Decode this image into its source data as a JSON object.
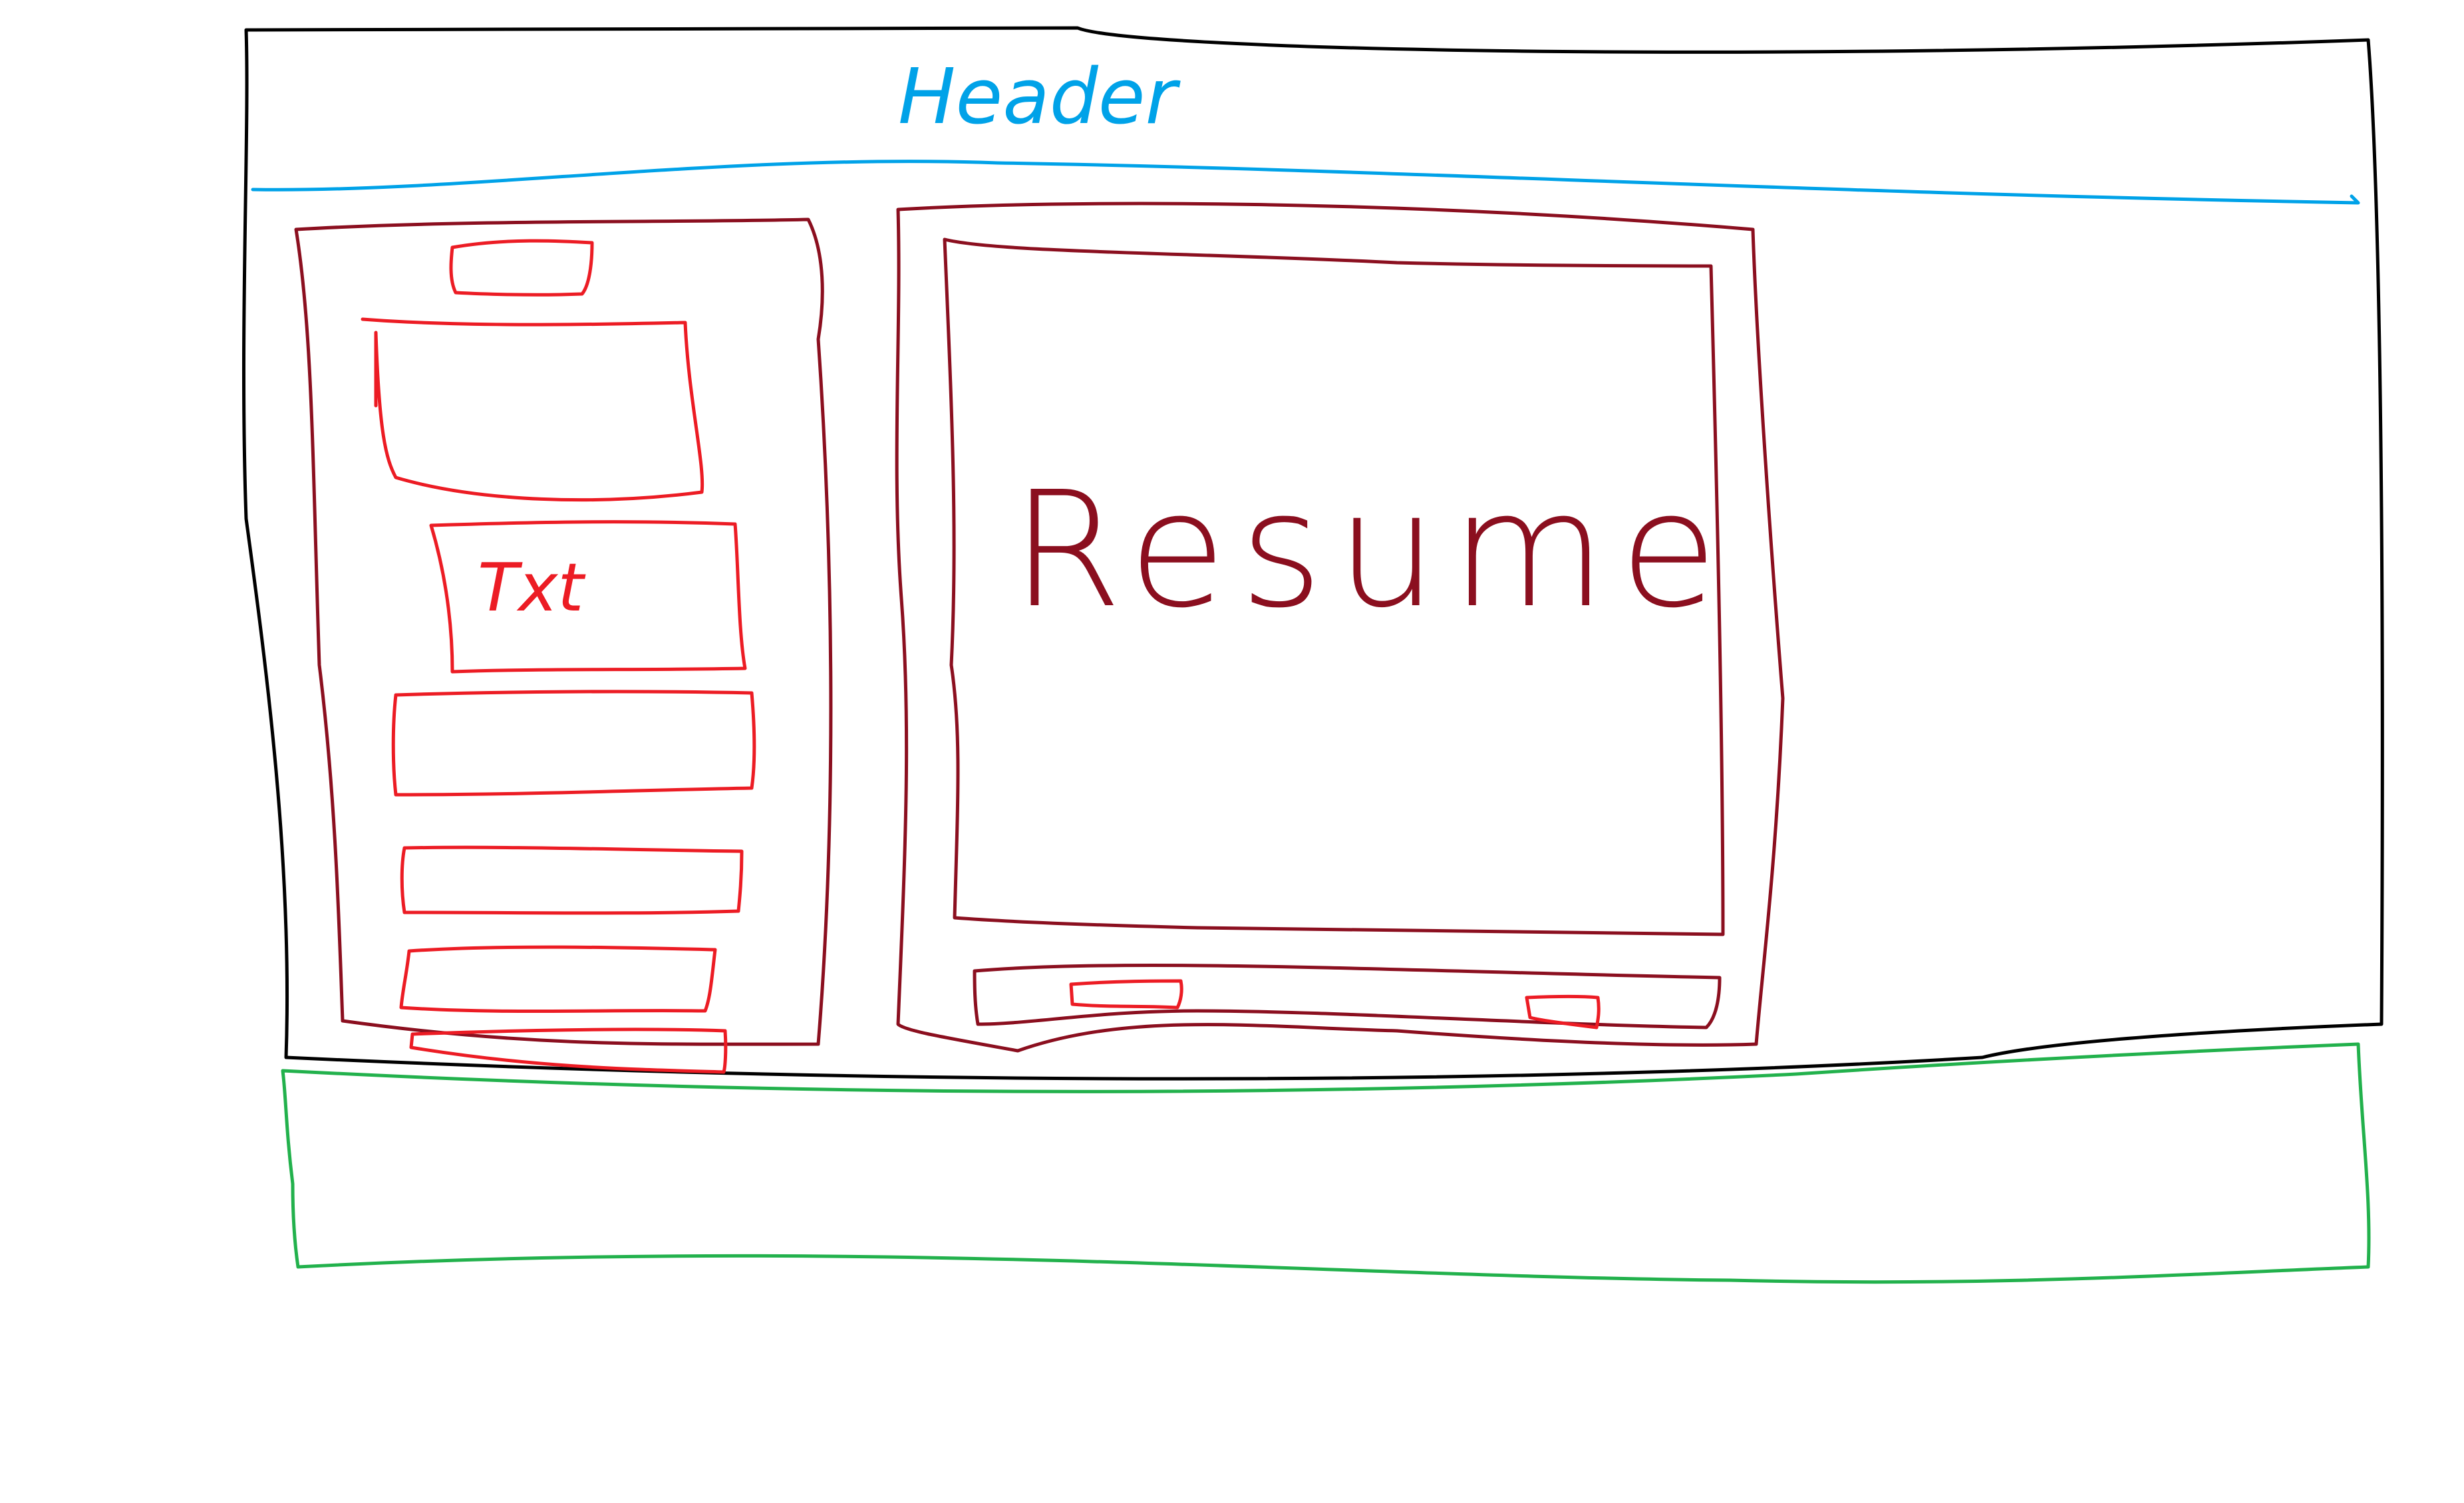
{
  "header": {
    "label": "Header",
    "color": "#00a2e8"
  },
  "sidebar": {
    "text_label": "Txt",
    "color": "#ec1c24",
    "frame_color": "#8b0f1f"
  },
  "resume": {
    "label": "Resume",
    "color": "#8b0f1f"
  },
  "footer": {
    "color": "#22b14c"
  },
  "page_frame": {
    "color": "#000000"
  }
}
